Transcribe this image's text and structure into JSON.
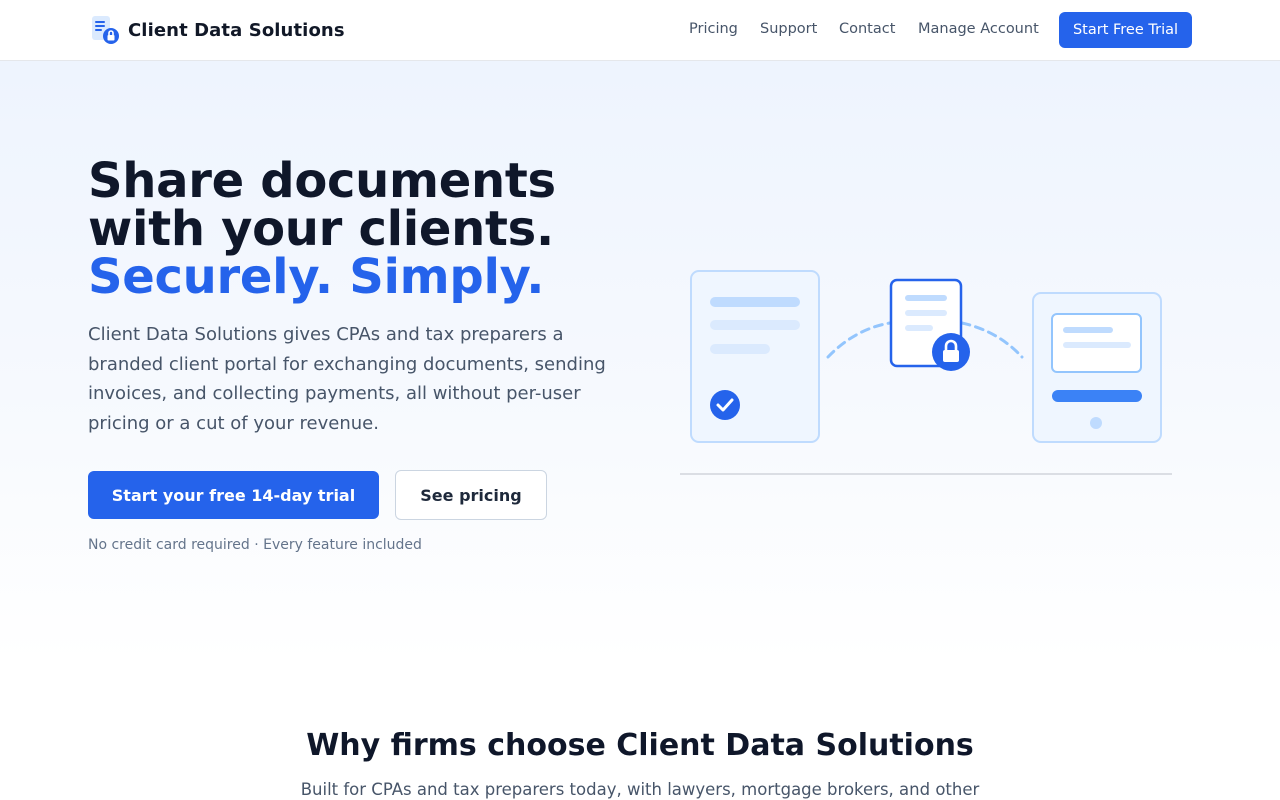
{
  "brand": {
    "name": "Client Data Solutions",
    "icon": "document-lock-icon",
    "accent_color": "#2563eb"
  },
  "nav": {
    "links": [
      "Pricing",
      "Support",
      "Contact",
      "Manage Account"
    ],
    "cta": "Start Free Trial"
  },
  "hero": {
    "title_line1": "Share documents",
    "title_line2": "with your clients.",
    "title_accent": "Securely. Simply.",
    "description": "Client Data Solutions gives CPAs and tax preparers a branded client portal for exchanging documents, sending invoices, and collecting payments, all without per-user pricing or a cut of your revenue.",
    "primary_cta": "Start your free 14-day trial",
    "secondary_cta": "See pricing",
    "note": "No credit card required · Every feature included",
    "illustration_icons": [
      "check-icon",
      "lock-icon",
      "document-icon",
      "portal-icon"
    ]
  },
  "why": {
    "title": "Why firms choose Client Data Solutions",
    "subtitle": "Built for CPAs and tax preparers today, with lawyers, mortgage brokers, and other"
  },
  "colors": {
    "primary": "#2563eb",
    "heading": "#0f172a",
    "body": "#475569",
    "muted": "#64748b",
    "illustration_fill": "#eff6ff",
    "illustration_stroke": "#bfdbfe"
  }
}
